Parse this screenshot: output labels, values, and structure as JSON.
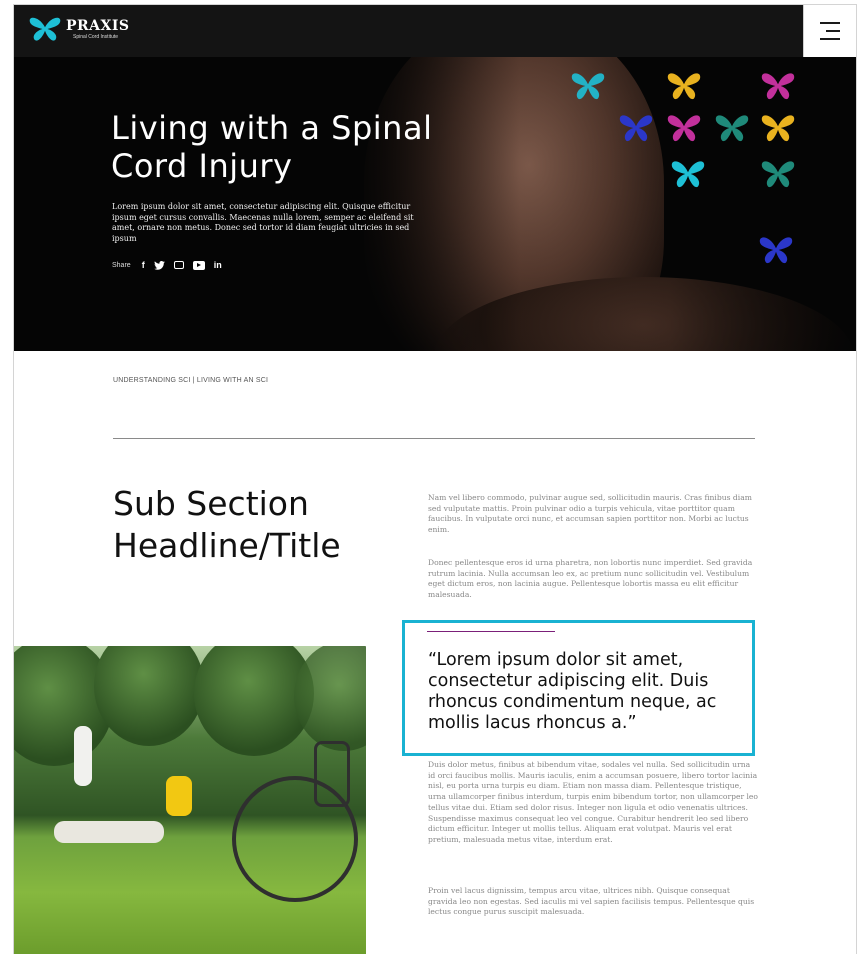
{
  "header": {
    "brand": "PRAXIS",
    "tagline": "Spinal Cord Institute",
    "logo_icon": "butterfly-logo-icon",
    "menu_icon": "hamburger-menu-icon"
  },
  "hero": {
    "title": "Living with a Spinal Cord Injury",
    "body": "Lorem ipsum dolor sit amet, consectetur adipiscing elit. Quisque efficitur ipsum eget cursus convallis. Maecenas nulla lorem, semper ac eleifend sit amet, ornare non metus. Donec sed tortor id diam feugiat ultricies in sed ipsum",
    "share_label": "Share",
    "social": {
      "facebook": "f",
      "linkedin": "in"
    },
    "butterfly_colors": [
      "#1ec0d6",
      "#e9b21f",
      "#c2309b",
      "#2b37c9",
      "#1f8a7a"
    ]
  },
  "breadcrumb": "UNDERSTANDING SCI | LIVING WITH AN SCI",
  "section": {
    "title": "Sub Section Headline/Title",
    "paragraphs": [
      "Nam vel libero commodo, pulvinar augue sed, sollicitudin mauris. Cras finibus diam sed vulputate mattis. Proin pulvinar odio a turpis vehicula, vitae porttitor quam faucibus. In vulputate orci nunc, et accumsan sapien porttitor non. Morbi ac luctus enim.",
      "Donec pellentesque eros id urna pharetra, non lobortis nunc imperdiet. Sed gravida rutrum lacinia. Nulla accumsan leo ex, ac pretium nunc sollicitudin vel. Vestibulum eget dictum eros, non lacinia augue. Pellentesque lobortis massa eu elit efficitur malesuada.",
      "Duis dolor metus, finibus at bibendum vitae, sodales vel nulla. Sed sollicitudin urna id orci faucibus mollis. Mauris iaculis, enim a accumsan posuere, libero tortor lacinia nisl, eu porta urna turpis eu diam. Etiam non massa diam. Pellentesque tristique, urna ullamcorper finibus interdum, turpis enim bibendum tortor, non ullamcorper leo tellus vitae dui. Etiam sed dolor risus. Integer non ligula et odio venenatis ultrices. Suspendisse maximus consequat leo vel congue. Curabitur hendrerit leo sed libero dictum efficitur. Integer ut mollis tellus. Aliquam erat volutpat. Mauris vel erat pretium, malesuada metus vitae, interdum erat.",
      "Proin vel lacus dignissim, tempus arcu vitae, ultrices nibh. Quisque consequat gravida leo non egestas. Sed iaculis mi vel sapien facilisis tempus. Pellentesque quis lectus congue purus suscipit malesuada."
    ],
    "quote": "“Lorem ipsum dolor sit amet, consectetur adipiscing elit. Duis rhoncus condimentum neque, ac mollis lacus rhoncus a.”",
    "quote_box_color": "#19b2d2",
    "quote_rule_color": "#7b1f79"
  }
}
